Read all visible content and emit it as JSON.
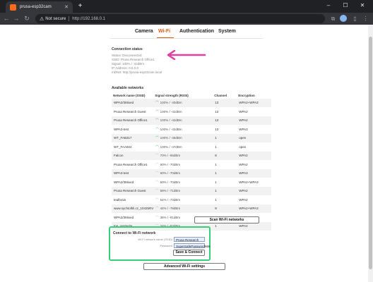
{
  "browser": {
    "tab_title": "prusa-esp32cam",
    "address_warning": "Not secure",
    "address_url": "http://192.168.0.1"
  },
  "nav": {
    "tabs": [
      {
        "label": "Camera"
      },
      {
        "label": "Wi-Fi"
      },
      {
        "label": "Authentication"
      },
      {
        "label": "System"
      }
    ],
    "active": "Wi-Fi"
  },
  "connection_status": {
    "heading": "Connection status",
    "lines": [
      "Status: Disconnected",
      "SSID: Prusa Research Office1",
      "Signal: 100% / -42dBm",
      "IP Address: 0.0.0.0",
      "mDNS: http://prusa-esp32cam.local"
    ]
  },
  "networks": {
    "heading": "Available networks",
    "columns": [
      "Network name (SSID)",
      "Signal strength (RSSI)",
      "Channel",
      "Encryption"
    ],
    "rows": [
      {
        "ssid": "WPA2/3Mixed",
        "signal": "100% / -40dBm",
        "channel": "13",
        "enc": "WPA2+WPA3",
        "strong": true
      },
      {
        "ssid": "Prusa Research Guest",
        "signal": "100% / -42dBm",
        "channel": "13",
        "enc": "WPA2",
        "strong": true
      },
      {
        "ssid": "Prusa Research Office1",
        "signal": "100% / -42dBm",
        "channel": "13",
        "enc": "WPA2",
        "strong": true
      },
      {
        "ssid": "WPA3-test",
        "signal": "100% / -42dBm",
        "channel": "13",
        "enc": "WPA3",
        "strong": true
      },
      {
        "ssid": "WT_FAB317",
        "signal": "100% / -46dBm",
        "channel": "1",
        "enc": "open",
        "strong": true
      },
      {
        "ssid": "WT_FAA924",
        "signal": "100% / -47dBm",
        "channel": "1",
        "enc": "open",
        "strong": true
      },
      {
        "ssid": "Falcon",
        "signal": "70% / -65dBm",
        "channel": "8",
        "enc": "WPA2",
        "strong": false
      },
      {
        "ssid": "Prusa Research Office1",
        "signal": "60% / -70dBm",
        "channel": "1",
        "enc": "WPA2",
        "strong": false
      },
      {
        "ssid": "WPA3-test",
        "signal": "60% / -70dBm",
        "channel": "1",
        "enc": "WPA3",
        "strong": false
      },
      {
        "ssid": "WPA2/3Mixed",
        "signal": "60% / -70dBm",
        "channel": "1",
        "enc": "WPA2+WPA3",
        "strong": false
      },
      {
        "ssid": "Prusa Research Guest",
        "signal": "58% / -71dBm",
        "channel": "1",
        "enc": "WPA2",
        "strong": false
      },
      {
        "ssid": "tealbrain",
        "signal": "54% / -73dBm",
        "channel": "1",
        "enc": "WPA2",
        "strong": false
      },
      {
        "ssid": "www.sychtolhli.cz_10425RV",
        "signal": "44% / -78dBm",
        "channel": "9",
        "enc": "WPA2+WPA3",
        "strong": false
      },
      {
        "ssid": "WPA2/3Mixed",
        "signal": "36% / -81dBm",
        "channel": "1",
        "enc": "WPA2+WPA3",
        "strong": false
      },
      {
        "ssid": "tpp_vystavite",
        "signal": "34% / -83dBm",
        "channel": "1",
        "enc": "WPA2",
        "strong": false
      }
    ],
    "scan_button": "Scan Wi-Fi networks"
  },
  "connect": {
    "heading": "Connect to Wi-Fi network",
    "ssid_label": "Wi-Fi network name (SSID)",
    "ssid_value": "Prusa Research Office1",
    "password_label": "Password",
    "password_value": "SuperSafePassword666",
    "button": "Save & Connect"
  },
  "advanced_button": "Advanced Wi-Fi settings",
  "colors": {
    "accent": "#e05a10",
    "annotation_arrow": "#e040a0",
    "highlight_box": "#34d17a",
    "signal_strong": "#2aa84a"
  }
}
